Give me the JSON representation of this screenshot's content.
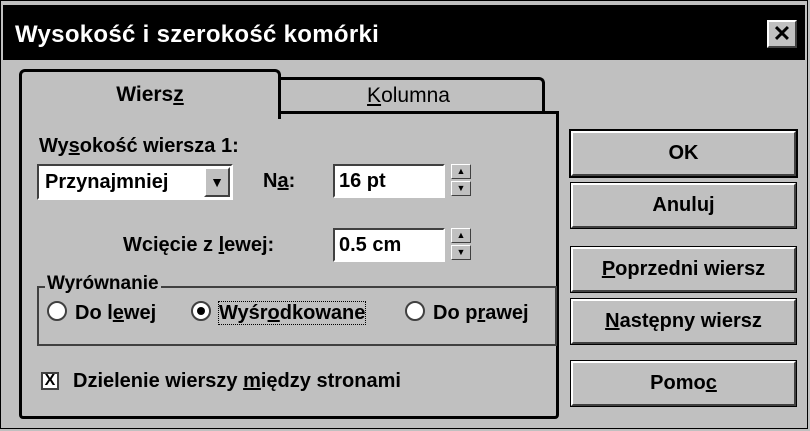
{
  "window": {
    "title": "Wysokość i szerokość komórki",
    "close_label": "✕"
  },
  "tabs": [
    {
      "pre": "Wiers",
      "key": "z",
      "post": ""
    },
    {
      "pre": "",
      "key": "K",
      "post": "olumna"
    }
  ],
  "row_height": {
    "label": {
      "pre": "Wy",
      "key": "s",
      "post": "okość wiersza 1:"
    },
    "mode_value": "Przynajmniej",
    "at_label": {
      "pre": "N",
      "key": "a",
      "post": ":"
    },
    "at_value": "16 pt"
  },
  "indent": {
    "label": {
      "pre": "Wcięcie z ",
      "key": "l",
      "post": "ewej:"
    },
    "value": "0.5 cm"
  },
  "alignment": {
    "legend": "Wyrównanie",
    "options": [
      {
        "pre": "Do l",
        "key": "e",
        "post": "wej",
        "selected": false
      },
      {
        "pre": "Wyśr",
        "key": "o",
        "post": "dkowane",
        "selected": true
      },
      {
        "pre": "Do p",
        "key": "r",
        "post": "awej",
        "selected": false
      }
    ]
  },
  "split_rows": {
    "checked": true,
    "mark": "X",
    "label": {
      "pre": "Dzielenie wierszy ",
      "key": "m",
      "post": "iędzy stronami"
    }
  },
  "buttons": {
    "ok": "OK",
    "cancel": "Anuluj",
    "prev": {
      "pre": "",
      "key": "P",
      "post": "oprzedni wiersz"
    },
    "next": {
      "pre": "",
      "key": "N",
      "post": "astępny wiersz"
    },
    "help": {
      "pre": "Pomo",
      "key": "c",
      "post": ""
    }
  }
}
